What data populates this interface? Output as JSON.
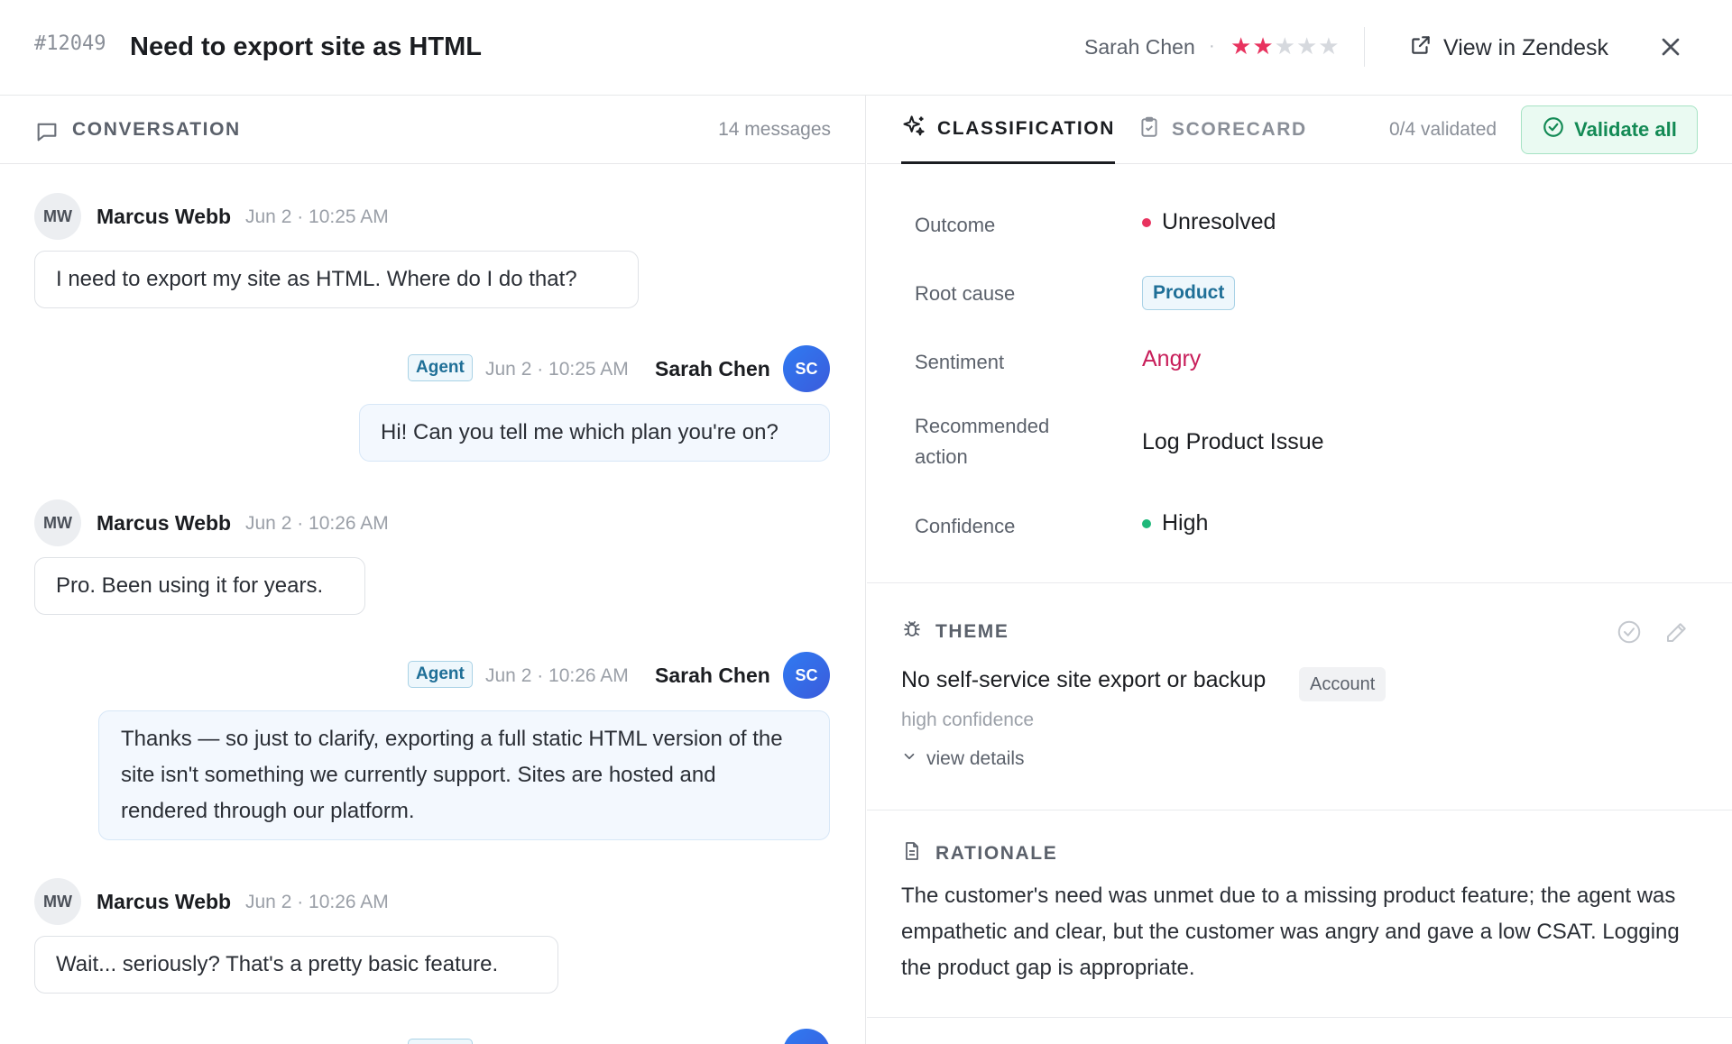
{
  "header": {
    "ticket_id": "#12049",
    "title": "Need to export site as HTML",
    "requester": "Sarah Chen",
    "rating": {
      "value": 2,
      "max": 5
    },
    "view_in_zendesk": "View in Zendesk"
  },
  "conversation": {
    "label": "CONVERSATION",
    "count": "14 messages",
    "messages": [
      {
        "role": "user",
        "initials": "MW",
        "author": "Marcus Webb",
        "time": "Jun 2 · 10:25 AM",
        "text": "I need to export my site as HTML. Where do I do that?"
      },
      {
        "role": "agent",
        "initials": "SC",
        "author": "Sarah Chen",
        "tag": "Agent",
        "time": "Jun 2 · 10:25 AM",
        "text": "Hi! Can you tell me which plan you're on?"
      },
      {
        "role": "user",
        "initials": "MW",
        "author": "Marcus Webb",
        "time": "Jun 2 · 10:26 AM",
        "text": "Pro. Been using it for years."
      },
      {
        "role": "agent",
        "initials": "SC",
        "author": "Sarah Chen",
        "tag": "Agent",
        "time": "Jun 2 · 10:26 AM",
        "text": "Thanks — so just to clarify, exporting a full static HTML version of the site isn't something we currently support. Sites are hosted and rendered through our platform."
      },
      {
        "role": "user",
        "initials": "MW",
        "author": "Marcus Webb",
        "time": "Jun 2 · 10:26 AM",
        "text": "Wait... seriously? That's a pretty basic feature."
      }
    ]
  },
  "tabs": {
    "classification": "CLASSIFICATION",
    "scorecard": "SCORECARD",
    "validated": "0/4 validated",
    "validate_all": "Validate all"
  },
  "classification": {
    "outcome_label": "Outcome",
    "outcome_value": "Unresolved",
    "root_cause_label": "Root cause",
    "root_cause_value": "Product",
    "sentiment_label": "Sentiment",
    "sentiment_value": "Angry",
    "action_label_1": "Recommended",
    "action_label_2": "action",
    "action_value": "Log Product Issue",
    "confidence_label": "Confidence",
    "confidence_value": "High"
  },
  "theme": {
    "label": "THEME",
    "text": "No self-service site export or backup",
    "category": "Account",
    "confidence": "high confidence",
    "view_details": "view details"
  },
  "rationale": {
    "label": "RATIONALE",
    "text": "The customer's need was unmet due to a missing product feature; the agent was empathetic and clear, but the customer was angry and gave a low CSAT. Logging the product gap is appropriate."
  },
  "colors": {
    "star_active": "#e8335f",
    "unresolved_dot": "#e8335f",
    "angry": "#c81e5a",
    "confidence_dot": "#1fb87a",
    "validate_green": "#138a55"
  }
}
